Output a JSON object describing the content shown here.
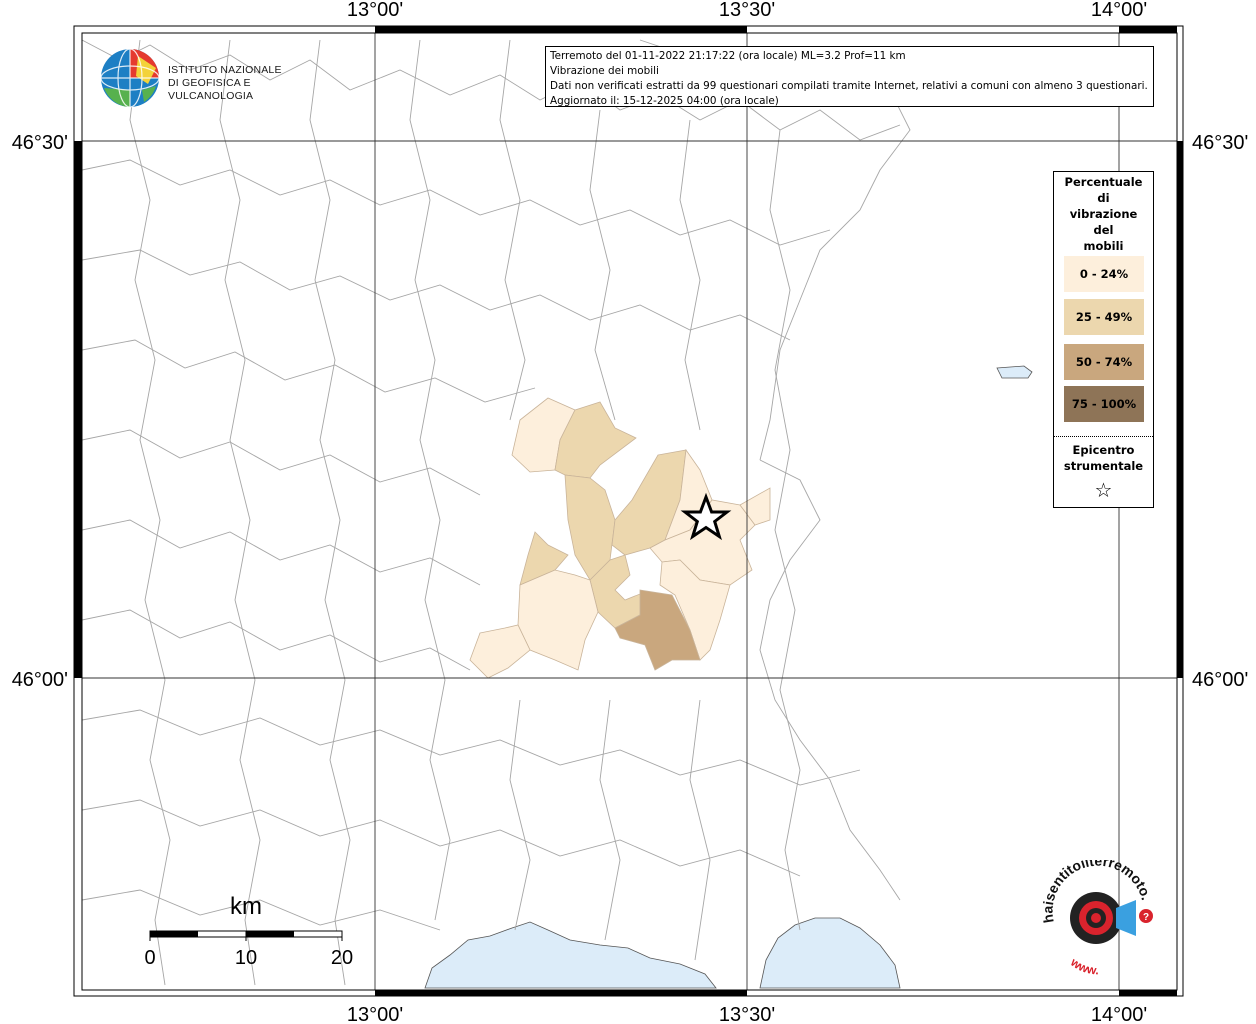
{
  "map": {
    "top_ticks": [
      "13°00'",
      "13°30'",
      "14°00'"
    ],
    "bottom_ticks": [
      "13°00'",
      "13°30'",
      "14°00'"
    ],
    "left_ticks": [
      "46°30'",
      "46°00'"
    ],
    "right_ticks": [
      "46°30'",
      "46°00'"
    ]
  },
  "info": {
    "line1": "Terremoto del 01-11-2022 21:17:22 (ora locale) ML=3.2 Prof=11 km",
    "line2": "Vibrazione dei mobili",
    "line3": "Dati non verificati estratti da 99 questionari compilati tramite Internet, relativi a comuni con almeno 3 questionari.",
    "line4": "Aggiornato il: 15-12-2025 04:00 (ora locale)"
  },
  "legend": {
    "title_lines": [
      "Percentuale",
      "di",
      "vibrazione",
      "del",
      "mobili"
    ],
    "classes": [
      {
        "label": "0 - 24%",
        "color": "#fdefdc"
      },
      {
        "label": "25 - 49%",
        "color": "#ecd7ae"
      },
      {
        "label": "50 - 74%",
        "color": "#c9a77e"
      },
      {
        "label": "75 - 100%",
        "color": "#8e7457"
      }
    ],
    "epicenter_lines": [
      "Epicentro",
      "strumentale"
    ],
    "epicenter_symbol": "☆"
  },
  "logo": {
    "line1": "ISTITUTO NAZIONALE",
    "line2": "DI GEOFISICA E VULCANOLOGIA",
    "icon": "ingv-globe-icon"
  },
  "scale": {
    "unit": "km",
    "labels": [
      "0",
      "10",
      "20"
    ]
  },
  "badge": {
    "text_top": "haisentitoilterremoto.it",
    "text_bottom": "www.",
    "question": "?",
    "icon": "haisentito-logo-icon"
  },
  "colors": {
    "sea": "#dcecf9",
    "border": "#9a9a9a",
    "frame": "#000000"
  }
}
